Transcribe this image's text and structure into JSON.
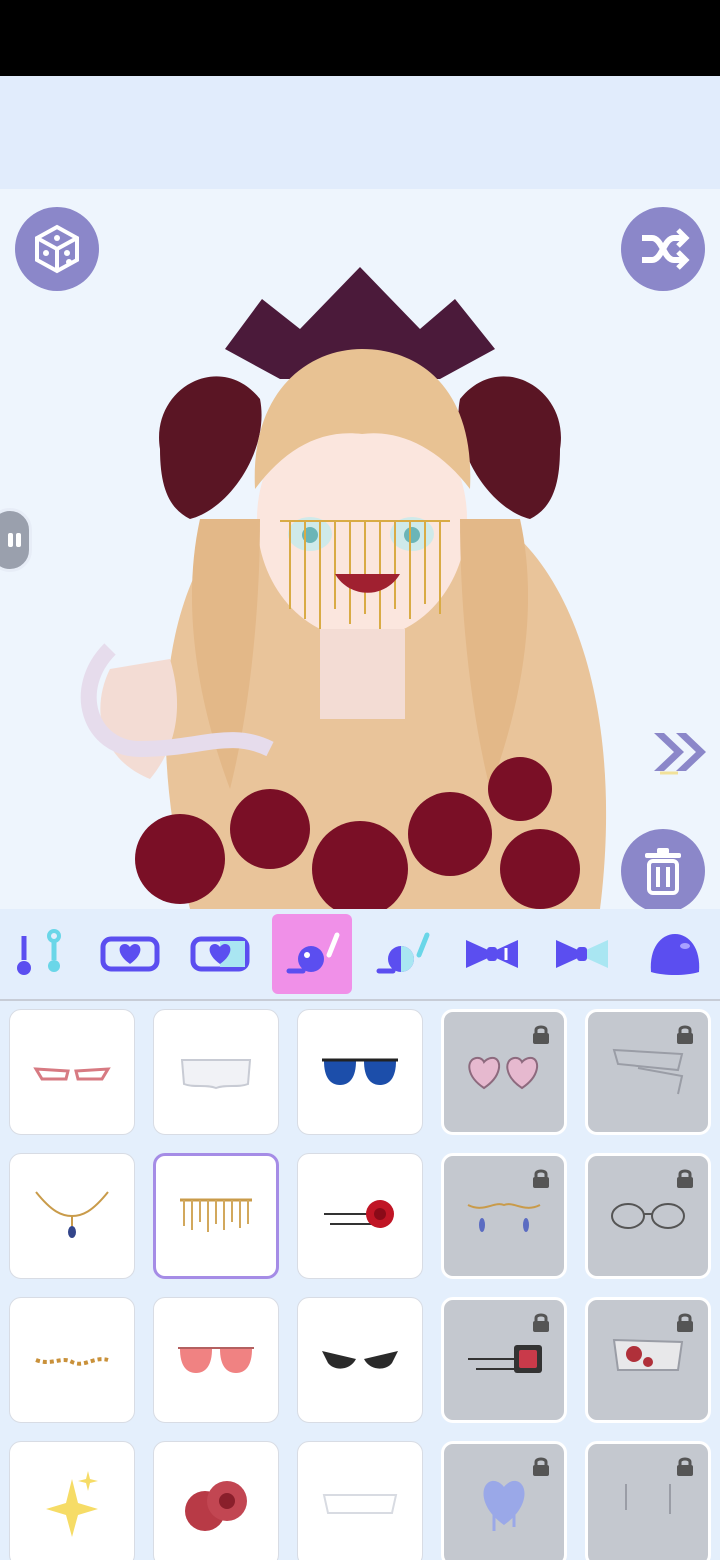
{
  "app": {
    "accent": "#8b87c9",
    "active_tab_color": "#f090e8",
    "tab_icon_color": "#5b4ef0"
  },
  "toolbar": {
    "random_icon": "dice-icon",
    "shuffle_icon": "shuffle-icon",
    "delete_icon": "trash-icon",
    "next_icon": "double-chevron-right-icon"
  },
  "tabs": [
    {
      "icon": "pendant-necklace-icon",
      "active": false
    },
    {
      "icon": "heart-belt-icon",
      "active": false
    },
    {
      "icon": "heart-belt-alt-icon",
      "active": false
    },
    {
      "icon": "face-accessory-icon",
      "active": true
    },
    {
      "icon": "face-accessory-alt-icon",
      "active": false
    },
    {
      "icon": "bow-icon",
      "active": false
    },
    {
      "icon": "bow-alt-icon",
      "active": false
    },
    {
      "icon": "blob-icon",
      "active": false
    }
  ],
  "items": [
    {
      "icon": "cat-eye-glasses-icon",
      "locked": false,
      "selected": false
    },
    {
      "icon": "ruffle-collar-icon",
      "locked": false,
      "selected": false
    },
    {
      "icon": "aviator-sunglasses-icon",
      "locked": false,
      "selected": false
    },
    {
      "icon": "heart-sunglasses-icon",
      "locked": true,
      "selected": false
    },
    {
      "icon": "bandage-mask-icon",
      "locked": true,
      "selected": false
    },
    {
      "icon": "gold-face-chain-icon",
      "locked": false,
      "selected": false
    },
    {
      "icon": "fringe-veil-icon",
      "locked": false,
      "selected": true
    },
    {
      "icon": "rose-hairpin-icon",
      "locked": false,
      "selected": false
    },
    {
      "icon": "teardrop-chain-icon",
      "locked": true,
      "selected": false
    },
    {
      "icon": "round-glasses-icon",
      "locked": true,
      "selected": false
    },
    {
      "icon": "star-chain-icon",
      "locked": false,
      "selected": false
    },
    {
      "icon": "pink-aviators-icon",
      "locked": false,
      "selected": false
    },
    {
      "icon": "black-cat-eye-sunglasses-icon",
      "locked": false,
      "selected": false
    },
    {
      "icon": "gem-hairpin-icon",
      "locked": true,
      "selected": false
    },
    {
      "icon": "bloody-mask-icon",
      "locked": true,
      "selected": false
    },
    {
      "icon": "sparkles-icon",
      "locked": false,
      "selected": false
    },
    {
      "icon": "roses-icon",
      "locked": false,
      "selected": false
    },
    {
      "icon": "white-band-icon",
      "locked": false,
      "selected": false
    },
    {
      "icon": "dripping-heart-icon",
      "locked": true,
      "selected": false
    },
    {
      "icon": "tear-drops-icon",
      "locked": true,
      "selected": false
    }
  ]
}
